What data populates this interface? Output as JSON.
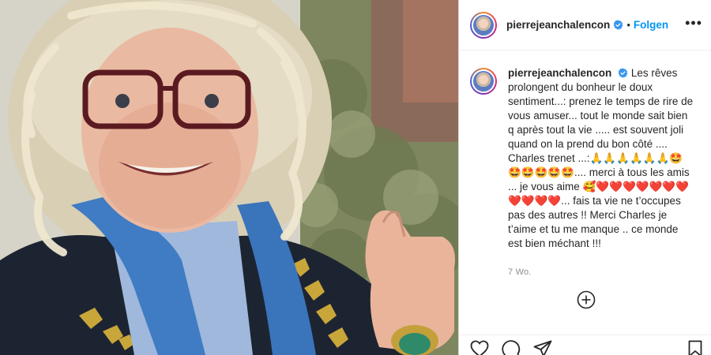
{
  "post": {
    "username": "pierrejeanchalencon",
    "separator": "•",
    "follow_label": "Folgen",
    "more_label": "•••",
    "caption": "Les rêves prolongent du bonheur le doux sentiment...: prenez le temps de rire de vous amuser... tout le monde sait bien q après tout la vie ..... est souvent joli quand on la prend du bon côté .... Charles trenet ...:🙏🙏🙏🙏🙏🙏🤩🤩🤩🤩🤩🤩.... merci à tous les amis ... je vous aime 🥰❤️❤️❤️❤️❤️❤️❤️❤️❤️❤️❤️... fais ta vie ne t’occupes pas des autres !! Merci Charles je t’aime et tu me manque .. ce monde est bien méchant !!!",
    "age": "7 Wo."
  },
  "icons": {
    "verified": "verified-badge-icon",
    "more": "more-options-icon",
    "add": "add-comment-icon",
    "like": "heart-icon",
    "comment": "comment-icon",
    "share": "share-icon",
    "save": "bookmark-icon"
  },
  "colors": {
    "accent": "#0095f6",
    "text": "#262626",
    "muted": "#8e8e8e"
  }
}
